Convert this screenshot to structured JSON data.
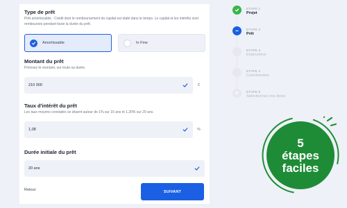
{
  "form": {
    "loan_type": {
      "title": "Type de prêt",
      "description": "Prêt amortissable : Crédit dont le remboursement du capital est étalé dans le temps. Le capital et les intérêts sont remboursés pendant toute la durée du prêt.",
      "options": [
        {
          "label": "Amortissable",
          "selected": true
        },
        {
          "label": "In Fine",
          "selected": false
        }
      ]
    },
    "amount": {
      "title": "Montant du prêt",
      "description": "Précisez le montant, sur toute sa durée.",
      "value": "210 000",
      "unit": "€"
    },
    "rate": {
      "title": "Taux d'intérêt du prêt",
      "description": "Les taux moyens constatés se situent autour de 1% sur 15 ans et 1,20% sur 20 ans.",
      "value": "1,08",
      "unit": "%"
    },
    "duration": {
      "title": "Durée initiale du prêt",
      "value": "20 ans"
    },
    "back_label": "Retour",
    "submit_label": "SUIVANT"
  },
  "steps": [
    {
      "kicker": "ETAPE 1",
      "name": "Projet",
      "state": "done"
    },
    {
      "kicker": "ETAPE 2",
      "name": "Prêt",
      "state": "current"
    },
    {
      "kicker": "ETAPE 3",
      "name": "Emprunteur",
      "state": "todo"
    },
    {
      "kicker": "ETAPE 4",
      "name": "Coordonnées",
      "state": "todo"
    },
    {
      "kicker": "ETAPE 5",
      "name": "Selectionnez vos devis",
      "state": "todo"
    }
  ],
  "badge": {
    "line1": "5",
    "line2": "étapes",
    "line3": "faciles"
  },
  "colors": {
    "accent": "#1b5fe3",
    "done": "#39b54a",
    "badge": "#1e8c36"
  }
}
